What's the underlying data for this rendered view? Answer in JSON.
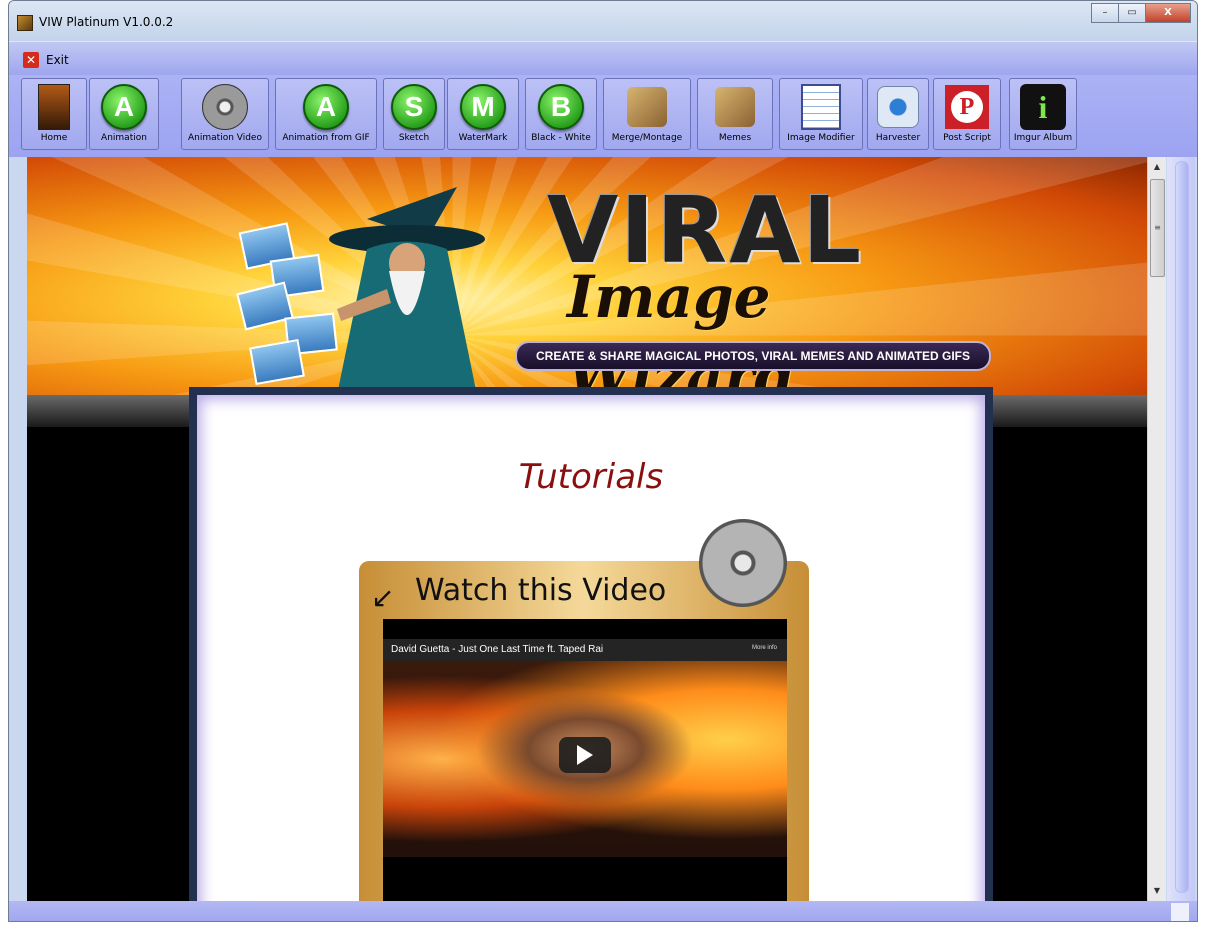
{
  "window": {
    "title": "VIW Platinum V1.0.0.2",
    "controls": {
      "minimize": "–",
      "maximize": "▭",
      "close": "X"
    }
  },
  "menu": {
    "exit_label": "Exit"
  },
  "toolbar": {
    "items": [
      {
        "label": "Home",
        "icon": "home-book-icon"
      },
      {
        "label": "Animation",
        "icon": "animation-a-icon",
        "glyph": "A"
      },
      {
        "label": "Animation Video",
        "icon": "film-reel-icon"
      },
      {
        "label": "Animation from GIF",
        "icon": "animation-gif-a-icon",
        "glyph": "A"
      },
      {
        "label": "Sketch",
        "icon": "sketch-s-icon",
        "glyph": "S"
      },
      {
        "label": "WaterMark",
        "icon": "watermark-m-icon",
        "glyph": "M"
      },
      {
        "label": "Black - White",
        "icon": "black-white-b-icon",
        "glyph": "B"
      },
      {
        "label": "Merge/Montage",
        "icon": "merge-montage-icon"
      },
      {
        "label": "Memes",
        "icon": "memes-palette-icon"
      },
      {
        "label": "Image Modifier",
        "icon": "notepad-pencil-icon"
      },
      {
        "label": "Harvester",
        "icon": "harvester-icon"
      },
      {
        "label": "Post Script",
        "icon": "pinterest-icon",
        "glyph": "P"
      },
      {
        "label": "Imgur Album",
        "icon": "imgur-info-icon",
        "glyph": "i"
      }
    ]
  },
  "banner": {
    "logo_line1": "VIRAL",
    "logo_line2": "Image Wizard",
    "tagline": "CREATE & SHARE MAGICAL PHOTOS, VIRAL MEMES AND ANIMATED GIFS"
  },
  "content": {
    "heading": "Tutorials",
    "video_box": {
      "title": "Watch this Video",
      "video_title": "David Guetta - Just One Last Time ft. Taped Rai",
      "more_info": "More info"
    }
  },
  "colors": {
    "heading": "#8a1010",
    "toolbar_bg": "#a5abf2",
    "panel_border": "#24304f"
  }
}
